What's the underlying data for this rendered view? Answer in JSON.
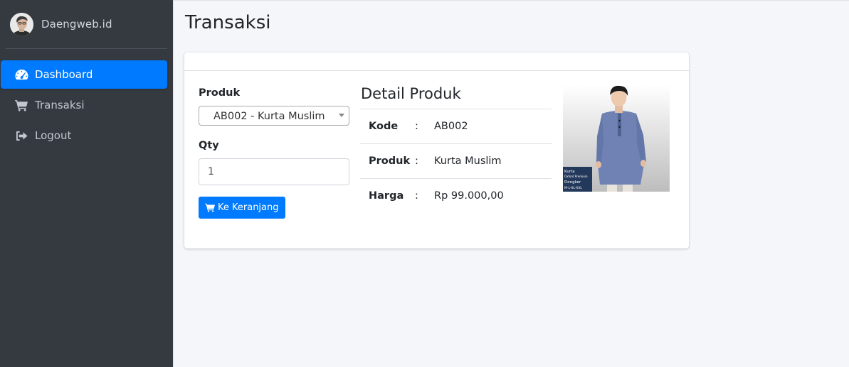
{
  "brand": {
    "name": "Daengweb.id"
  },
  "sidebar": {
    "items": [
      {
        "label": "Dashboard",
        "icon": "tachometer-icon",
        "active": true
      },
      {
        "label": "Transaksi",
        "icon": "shopping-cart-icon",
        "active": false
      },
      {
        "label": "Logout",
        "icon": "sign-out-icon",
        "active": false
      }
    ]
  },
  "page": {
    "title": "Transaksi"
  },
  "form": {
    "produk_label": "Produk",
    "produk_selected": "AB002 - Kurta Muslim",
    "qty_label": "Qty",
    "qty_value": "1",
    "cart_button": "Ke Keranjang"
  },
  "detail": {
    "title": "Detail Produk",
    "separator": ":",
    "rows": [
      {
        "label": "Kode",
        "value": "AB002"
      },
      {
        "label": "Produk",
        "value": "Kurta Muslim"
      },
      {
        "label": "Harga",
        "value": "Rp 99.000,00"
      }
    ]
  },
  "product_image": {
    "caption_lines": [
      "Kurta",
      "Oxford Premium",
      "Dongker",
      "M-L-XL-XXL"
    ]
  },
  "colors": {
    "sidebar_bg": "#343a40",
    "accent": "#007bff",
    "content_bg": "#f4f6f9"
  }
}
